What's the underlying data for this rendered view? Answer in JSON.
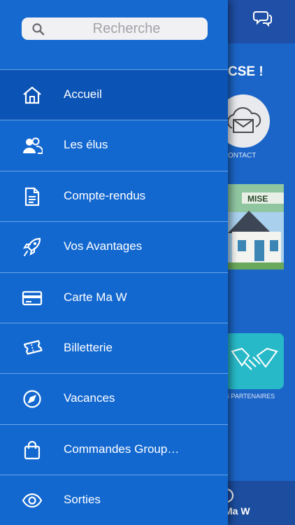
{
  "search": {
    "placeholder": "Recherche"
  },
  "menu": {
    "items": [
      {
        "label": "Accueil",
        "icon": "home-icon"
      },
      {
        "label": "Les élus",
        "icon": "users-icon"
      },
      {
        "label": "Compte-rendus",
        "icon": "document-icon"
      },
      {
        "label": "Vos Avantages",
        "icon": "rocket-icon"
      },
      {
        "label": "Carte Ma W",
        "icon": "card-icon"
      },
      {
        "label": "Billetterie",
        "icon": "ticket-icon"
      },
      {
        "label": "Vacances",
        "icon": "compass-icon"
      },
      {
        "label": "Commandes Group…",
        "icon": "bag-icon"
      },
      {
        "label": "Sorties",
        "icon": "eye-icon"
      }
    ]
  },
  "background": {
    "welcome_text": "CSE !",
    "contact_label": "ONTACT",
    "promo_badge": "MISE",
    "partners_label": "S PARTENAIRES",
    "bottom_tab_label": "Ma W"
  },
  "colors": {
    "drawer": "#1368d0",
    "active_item": "#0b53b5",
    "divider": "#6aa3e6",
    "topbar": "#1f4fa6",
    "partners_tile": "#27b9c8"
  }
}
